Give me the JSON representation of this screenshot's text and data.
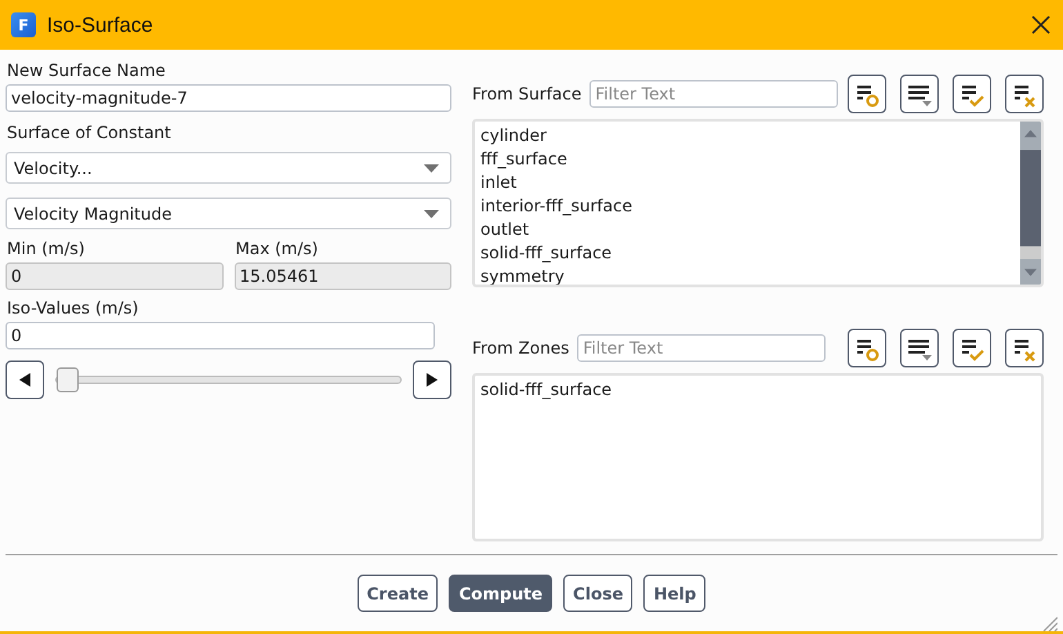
{
  "window": {
    "title": "Iso-Surface",
    "app_letter": "F"
  },
  "new_surface_name": {
    "label": "New Surface Name",
    "value": "velocity-magnitude-7"
  },
  "surface_of_constant": {
    "label": "Surface of Constant",
    "category": "Velocity...",
    "field": "Velocity Magnitude"
  },
  "min": {
    "label": "Min (m/s)",
    "value": "0"
  },
  "max": {
    "label": "Max (m/s)",
    "value": "15.05461"
  },
  "iso_values": {
    "label": "Iso-Values (m/s)",
    "value": "0",
    "level": 0
  },
  "from_surface": {
    "label": "From Surface",
    "placeholder": "Filter Text",
    "items": [
      {
        "label": "cylinder",
        "selected": false
      },
      {
        "label": "fff_surface",
        "selected": false
      },
      {
        "label": "inlet",
        "selected": false
      },
      {
        "label": "interior-fff_surface",
        "selected": false
      },
      {
        "label": "outlet",
        "selected": false
      },
      {
        "label": "solid-fff_surface",
        "selected": false
      },
      {
        "label": "symmetry",
        "selected": false
      }
    ]
  },
  "from_zones": {
    "label": "From Zones",
    "placeholder": "Filter Text",
    "items": [
      {
        "label": "solid-fff_surface",
        "selected": false
      }
    ]
  },
  "buttons": [
    {
      "label": "Create",
      "default": false
    },
    {
      "label": "Compute",
      "default": true
    },
    {
      "label": "Close",
      "default": false
    },
    {
      "label": "Help",
      "default": false
    }
  ]
}
